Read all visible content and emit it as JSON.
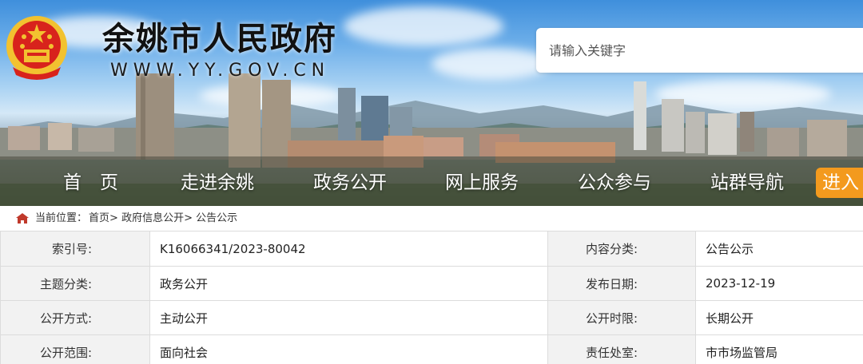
{
  "header": {
    "site_title": "余姚市人民政府",
    "domain": "WWW.YY.GOV.CN",
    "emblem_icon": "national-emblem-icon"
  },
  "search": {
    "placeholder": "请输入关键字"
  },
  "nav": {
    "items": [
      {
        "label": "首　页"
      },
      {
        "label": "走进余姚"
      },
      {
        "label": "政务公开"
      },
      {
        "label": "网上服务"
      },
      {
        "label": "公众参与"
      },
      {
        "label": "站群导航"
      }
    ],
    "enter_label": "进入",
    "enter_color": "#f39a1e"
  },
  "breadcrumb": {
    "icon": "home-icon",
    "label": "当前位置：",
    "items": [
      "首页",
      "政府信息公开",
      "公告公示"
    ],
    "separator": ">"
  },
  "info": {
    "rows": [
      {
        "label1": "索引号:",
        "value1": "K16066341/2023-80042",
        "label2": "内容分类:",
        "value2": "公告公示"
      },
      {
        "label1": "主题分类:",
        "value1": "政务公开",
        "label2": "发布日期:",
        "value2": "2023-12-19"
      },
      {
        "label1": "公开方式:",
        "value1": "主动公开",
        "label2": "公开时限:",
        "value2": "长期公开"
      },
      {
        "label1": "公开范围:",
        "value1": "面向社会",
        "label2": "责任处室:",
        "value2": "市市场监管局"
      }
    ]
  },
  "colors": {
    "accent_orange": "#f39a1e",
    "label_cell_bg": "#f2f2f2",
    "table_border": "#dcdcdc",
    "emblem_red": "#d8231c",
    "emblem_gold": "#f2c230"
  }
}
